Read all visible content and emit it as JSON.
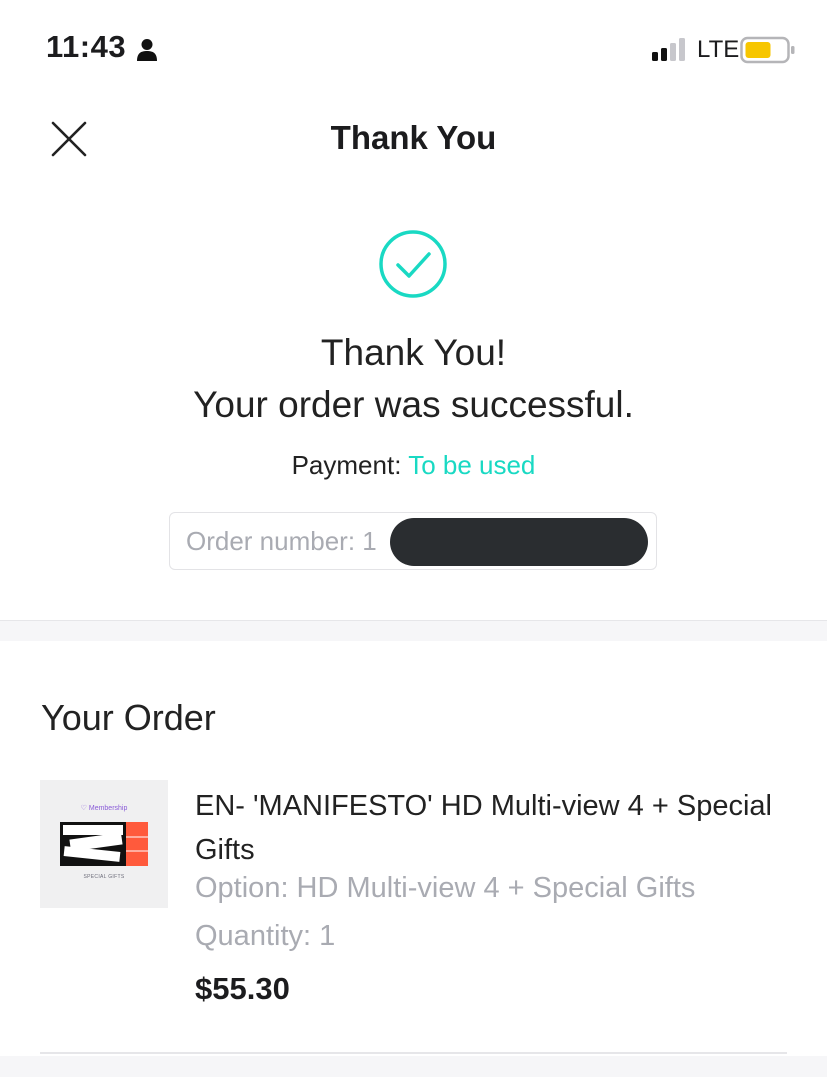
{
  "status_bar": {
    "time": "11:43",
    "network": "LTE",
    "icons": [
      "person-icon",
      "signal-icon",
      "battery-icon"
    ]
  },
  "nav": {
    "title": "Thank You",
    "close_icon": "close-icon"
  },
  "success": {
    "icon": "check-circle-icon",
    "line1": "Thank You!",
    "line2": "Your order was successful.",
    "payment_label": "Payment:",
    "payment_status": "To be used",
    "order_number_label": "Order number: 1"
  },
  "order": {
    "section_title": "Your Order",
    "item": {
      "thumbnail_badge": "Membership",
      "thumbnail_caption": "SPECIAL GIFTS",
      "name": "EN- 'MANIFESTO' HD Multi-view 4 + Special Gifts",
      "option": "Option: HD Multi-view 4 + Special Gifts",
      "quantity": "Quantity: 1",
      "price": "$55.30"
    }
  },
  "colors": {
    "accent": "#19d9c3",
    "muted_text": "#a9abb2",
    "battery": "#f7c600"
  }
}
